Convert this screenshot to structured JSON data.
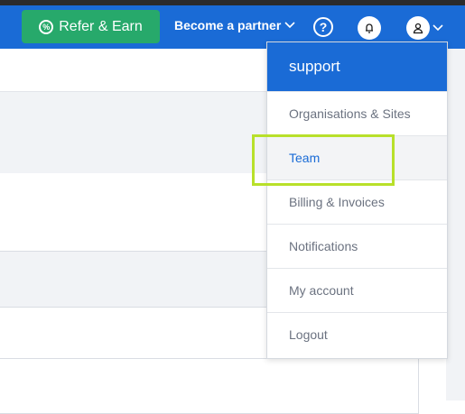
{
  "topbar": {
    "refer_label": "Refer & Earn",
    "refer_icon": "percent-badge-icon",
    "partner_label": "Become a partner",
    "help_icon": "help-circle-icon",
    "bell_icon": "bell-icon",
    "avatar_icon": "user-icon",
    "accent": "#1a6bd6",
    "refer_color": "#27a96b"
  },
  "dropdown": {
    "header": "support",
    "items": [
      {
        "label": "Organisations & Sites"
      },
      {
        "label": "Team"
      },
      {
        "label": "Billing & Invoices"
      },
      {
        "label": "Notifications"
      },
      {
        "label": "My account"
      },
      {
        "label": "Logout"
      }
    ],
    "active_index": 1,
    "highlight_color": "#b8e02a"
  }
}
